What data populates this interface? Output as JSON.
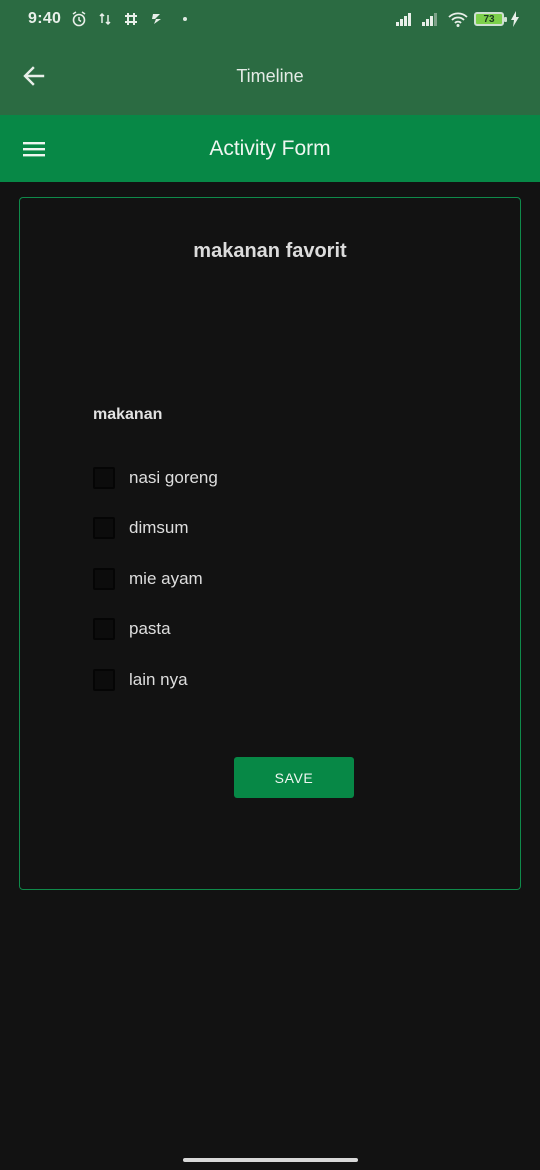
{
  "status_bar": {
    "time": "9:40",
    "battery_level": "73",
    "icons": [
      "alarm-icon",
      "data-transfer-icon",
      "slack-icon",
      "notification-icon",
      "signal-icon",
      "signal-icon",
      "wifi-icon",
      "battery-icon",
      "charging-icon"
    ]
  },
  "top_bar": {
    "title": "Timeline",
    "back_icon": "arrow-left-icon"
  },
  "app_bar": {
    "title": "Activity Form",
    "menu_icon": "hamburger-menu-icon"
  },
  "form": {
    "title": "makanan favorit",
    "group_label": "makanan",
    "options": [
      {
        "label": "nasi goreng",
        "checked": false
      },
      {
        "label": "dimsum",
        "checked": false
      },
      {
        "label": "mie ayam",
        "checked": false
      },
      {
        "label": "pasta",
        "checked": false
      },
      {
        "label": "lain nya",
        "checked": false
      }
    ],
    "save_label": "SAVE"
  },
  "colors": {
    "status_bar_bg": "#2b6b42",
    "app_bar_bg": "#078846",
    "background": "#121212",
    "card_border": "#0f8a4a",
    "button_bg": "#078846"
  }
}
